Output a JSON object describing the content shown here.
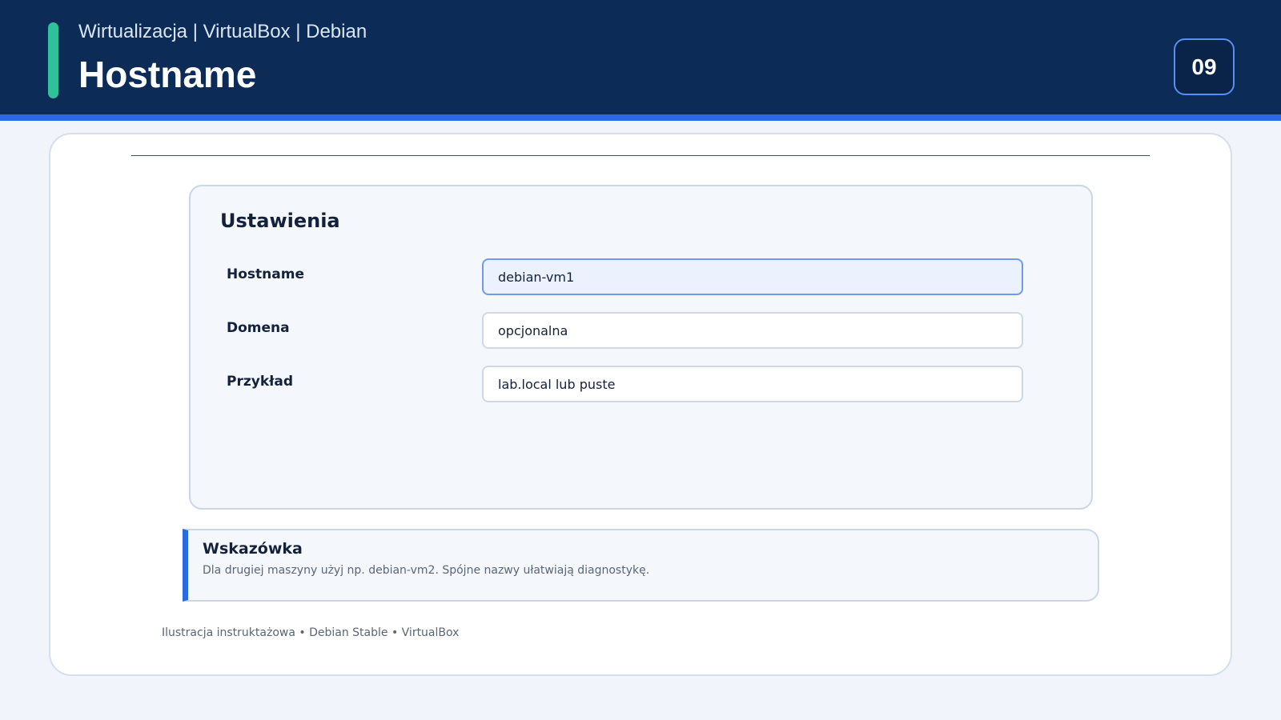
{
  "header": {
    "subtitle": "Wirtualizacja | VirtualBox | Debian",
    "title": "Hostname",
    "slide_number": "09"
  },
  "settings": {
    "title": "Ustawienia",
    "fields": [
      {
        "label": "Hostname",
        "value": "debian-vm1"
      },
      {
        "label": "Domena",
        "value": "opcjonalna"
      },
      {
        "label": "Przykład",
        "value": "lab.local lub puste"
      }
    ]
  },
  "hint": {
    "title": "Wskazówka",
    "text": "Dla drugiej maszyny użyj np. debian-vm2. Spójne nazwy ułatwiają diagnostykę."
  },
  "footer": {
    "text": "Ilustracja instruktażowa • Debian Stable • VirtualBox"
  },
  "colors": {
    "header_bg": "#0c2b57",
    "accent_green": "#2fc29a",
    "accent_blue": "#2b6be2",
    "focused_field_bg": "#ebf2fe"
  }
}
